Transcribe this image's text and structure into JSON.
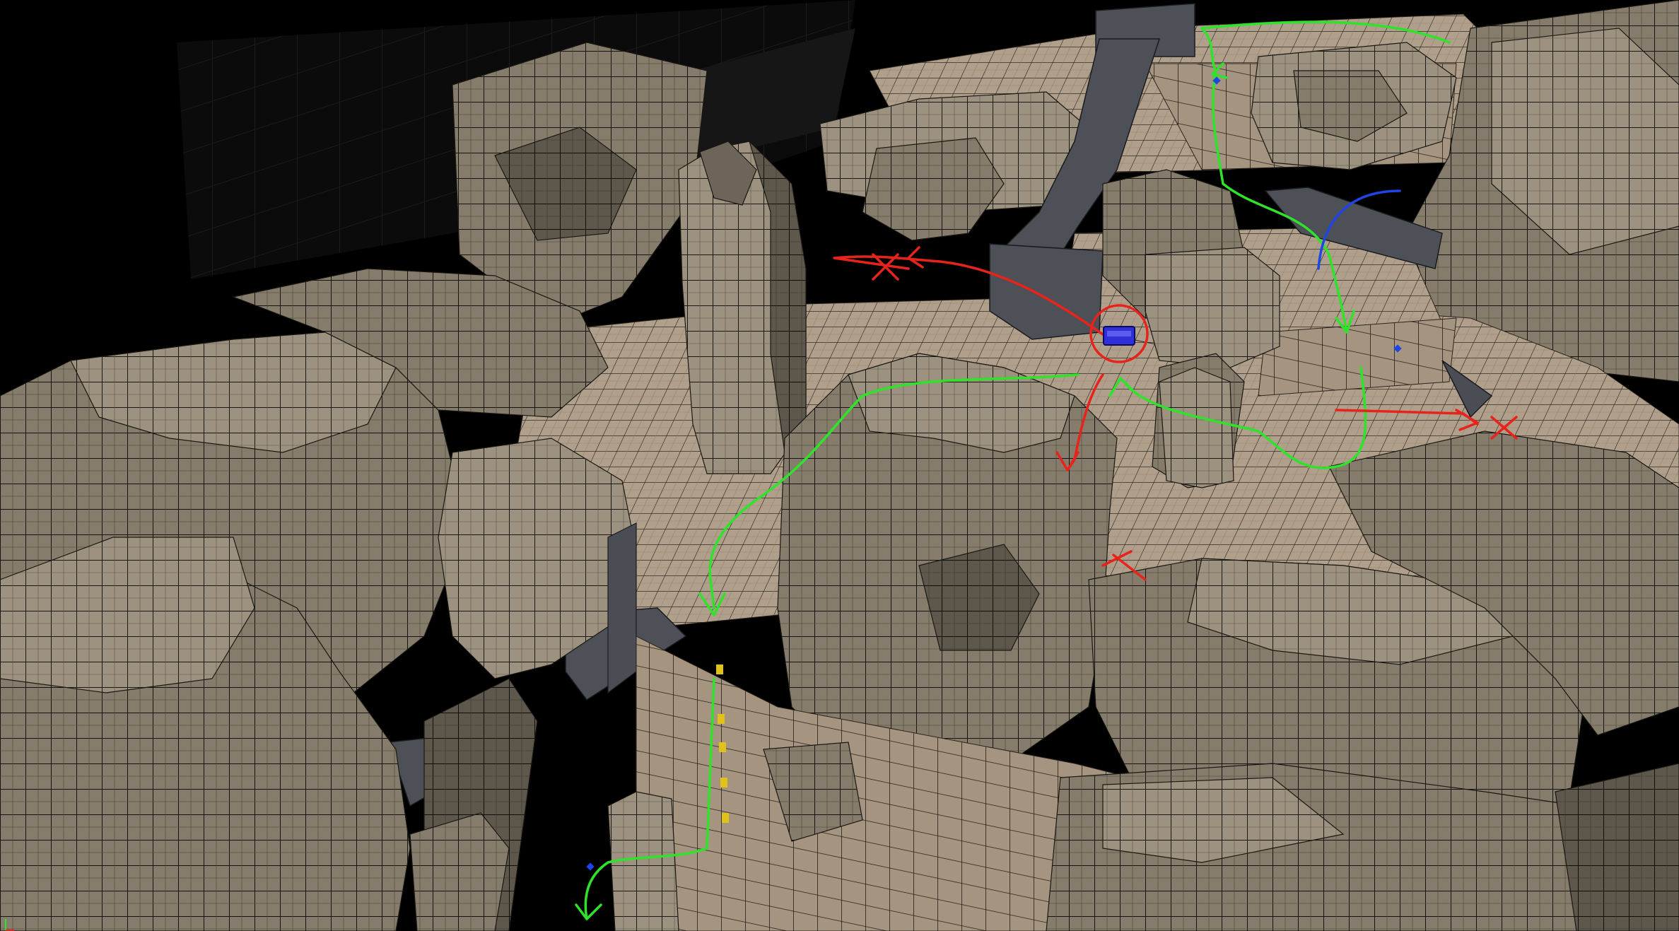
{
  "viewport": {
    "background": "#000000",
    "colors": {
      "rock": "#8a8170",
      "rock_dark": "#5a5347",
      "floor": "#ad9d89",
      "grid": "#1a1814",
      "metal": "#4e5057",
      "route_safe": "#2fe32b",
      "route_danger": "#e8231b",
      "route_alt": "#1f45e6",
      "player": "#2f2fd8",
      "marker": "#e0c21a"
    }
  },
  "scene": {
    "structures": [
      "rock-formation",
      "stone-pillar",
      "metal-ramp",
      "metal-walkway",
      "floor-platform",
      "cliff-wall"
    ],
    "player_marker": "player-vehicle-icon",
    "routes": {
      "safe_paths": 4,
      "danger_paths": 3,
      "blocked_markers": 3,
      "alternate_paths": 1
    },
    "ledge_markers": 5
  }
}
